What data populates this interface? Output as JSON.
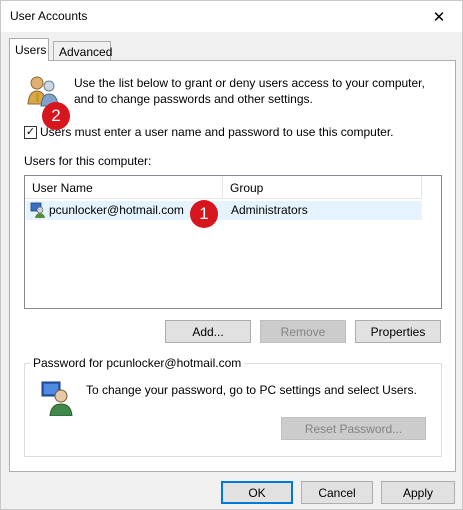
{
  "window": {
    "title": "User Accounts",
    "close_icon": "close-icon"
  },
  "tabs": [
    {
      "label": "Users",
      "active": true
    },
    {
      "label": "Advanced",
      "active": false
    }
  ],
  "intro": {
    "line1": "Use the list below to grant or deny users access to your computer,",
    "line2": "and to change passwords and other settings."
  },
  "require_login": {
    "checked": true,
    "label": "Users must enter a user name and password to use this computer."
  },
  "users_section_label": "Users for this computer:",
  "users_table": {
    "columns": [
      "User Name",
      "Group"
    ],
    "rows": [
      {
        "user_name": "pcunlocker@hotmail.com",
        "group": "Administrators"
      }
    ]
  },
  "user_buttons": {
    "add": "Add...",
    "remove": "Remove",
    "properties": "Properties"
  },
  "password_group": {
    "label": "Password for pcunlocker@hotmail.com",
    "text": "To change your password, go to PC settings and select Users.",
    "reset_button": "Reset Password..."
  },
  "dialog_buttons": {
    "ok": "OK",
    "cancel": "Cancel",
    "apply": "Apply"
  },
  "badges": {
    "one": "1",
    "two": "2"
  },
  "colors": {
    "badge": "#d6151d",
    "selection": "#e5f3ff",
    "default_button_border": "#0078d7"
  }
}
